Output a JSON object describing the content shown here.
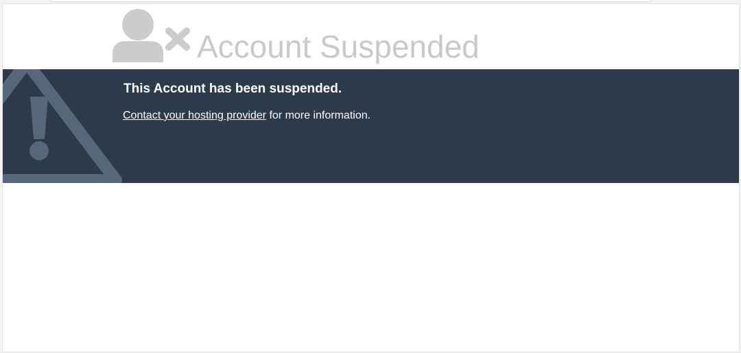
{
  "header": {
    "title": "Account Suspended",
    "icon": "user-x-icon"
  },
  "banner": {
    "heading": "This Account has been suspended.",
    "link_text": "Contact your hosting provider",
    "trailing_text": " for more information.",
    "icon": "warning-icon"
  },
  "colors": {
    "banner_bg": "#2c3a4b",
    "title_gray": "#c9c9c9",
    "icon_gray": "#cccccc",
    "warning_gray": "#56677a",
    "text_white": "#ffffff"
  }
}
